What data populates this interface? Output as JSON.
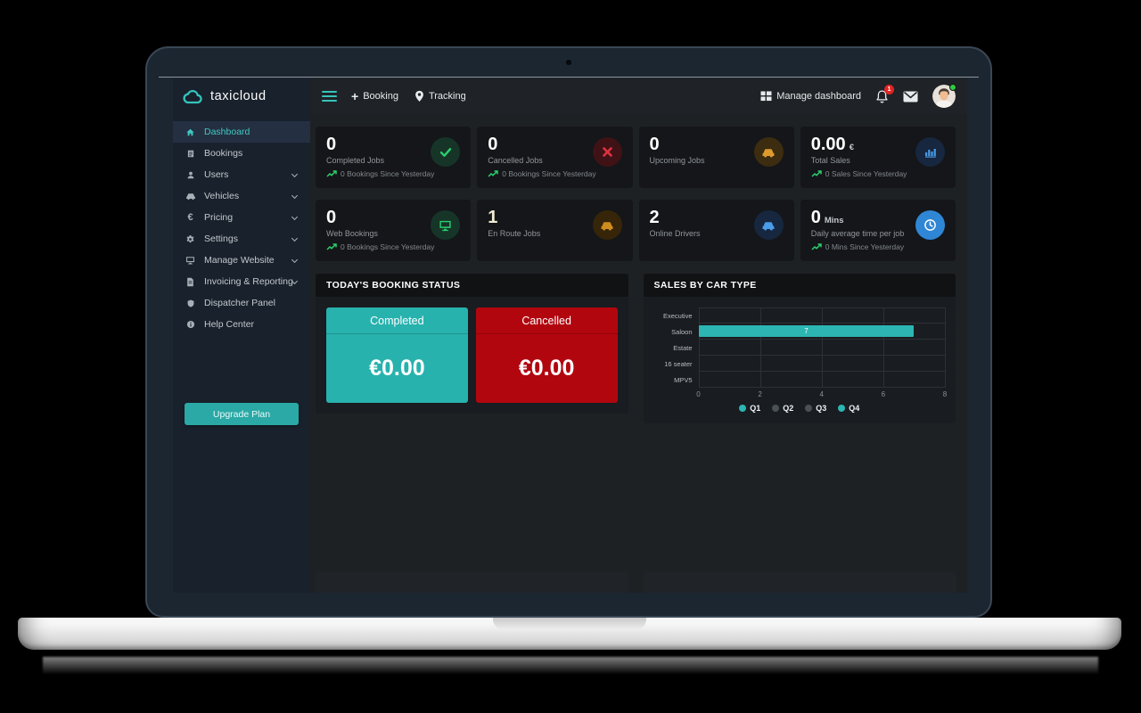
{
  "logo": {
    "text": "taxicloud"
  },
  "topbar": {
    "booking_label": "Booking",
    "tracking_label": "Tracking",
    "manage_dashboard_label": "Manage dashboard",
    "notification_count": "1"
  },
  "sidebar": {
    "items": [
      {
        "label": "Dashboard",
        "icon": "home-icon",
        "active": true
      },
      {
        "label": "Bookings",
        "icon": "bookings-icon"
      },
      {
        "label": "Users",
        "icon": "user-icon",
        "expandable": true
      },
      {
        "label": "Vehicles",
        "icon": "car-icon",
        "expandable": true
      },
      {
        "label": "Pricing",
        "icon": "euro-icon",
        "expandable": true
      },
      {
        "label": "Settings",
        "icon": "gear-icon",
        "expandable": true
      },
      {
        "label": "Manage Website",
        "icon": "monitor-icon",
        "expandable": true
      },
      {
        "label": "Invoicing & Reporting",
        "icon": "document-icon",
        "expandable": true
      },
      {
        "label": "Dispatcher Panel",
        "icon": "shield-icon"
      },
      {
        "label": "Help Center",
        "icon": "info-icon"
      }
    ],
    "upgrade_label": "Upgrade Plan"
  },
  "stats": [
    {
      "value": "0",
      "label": "Completed Jobs",
      "sub": "0 Bookings Since Yesterday",
      "icon": "check-icon"
    },
    {
      "value": "0",
      "label": "Cancelled Jobs",
      "sub": "0 Bookings Since Yesterday",
      "icon": "cancel-icon"
    },
    {
      "value": "0",
      "label": "Upcoming Jobs",
      "icon": "car-icon"
    },
    {
      "value": "0.00",
      "unit": "€",
      "label": "Total Sales",
      "sub": "0 Sales Since Yesterday",
      "icon": "bar-chart-icon"
    },
    {
      "value": "0",
      "label": "Web Bookings",
      "sub": "0 Bookings Since Yesterday",
      "icon": "monitor-icon"
    },
    {
      "value": "1",
      "label": "En Route Jobs",
      "icon": "car-icon"
    },
    {
      "value": "2",
      "label": "Online Drivers",
      "icon": "car-icon"
    },
    {
      "value": "0",
      "unit": "Mins",
      "label": "Daily average time per job",
      "sub": "0 Mins Since Yesterday",
      "icon": "clock-icon"
    }
  ],
  "booking_status": {
    "title": "TODAY'S BOOKING STATUS",
    "tiles": [
      {
        "label": "Completed",
        "amount": "€0.00",
        "color": "#28b2ae"
      },
      {
        "label": "Cancelled",
        "amount": "€0.00",
        "color": "#b2060f"
      }
    ]
  },
  "chart": {
    "title": "SALES BY CAR TYPE",
    "chart_data": {
      "type": "bar",
      "orientation": "horizontal",
      "categories": [
        "Executive",
        "Saloon",
        "Estate",
        "16 seater",
        "MPV5"
      ],
      "series": [
        {
          "name": "Q1",
          "color": "#2cb5b2",
          "values": [
            0,
            7,
            0,
            0,
            0
          ]
        },
        {
          "name": "Q2",
          "color": "#4a5156",
          "values": [
            0,
            0,
            0,
            0,
            0
          ]
        },
        {
          "name": "Q3",
          "color": "#4a5156",
          "values": [
            0,
            0,
            0,
            0,
            0
          ]
        },
        {
          "name": "Q4",
          "color": "#2cb5b2",
          "values": [
            0,
            0,
            0,
            0,
            0
          ]
        }
      ],
      "xlim": [
        0,
        8
      ],
      "xticks": [
        0,
        2,
        4,
        6,
        8
      ],
      "grid": true,
      "legend_position": "bottom"
    }
  },
  "colors": {
    "accent": "#2cb5b2",
    "success": "#2ad06e",
    "danger": "#e2333f",
    "warning": "#de9b2d",
    "info": "#4a9be8"
  }
}
